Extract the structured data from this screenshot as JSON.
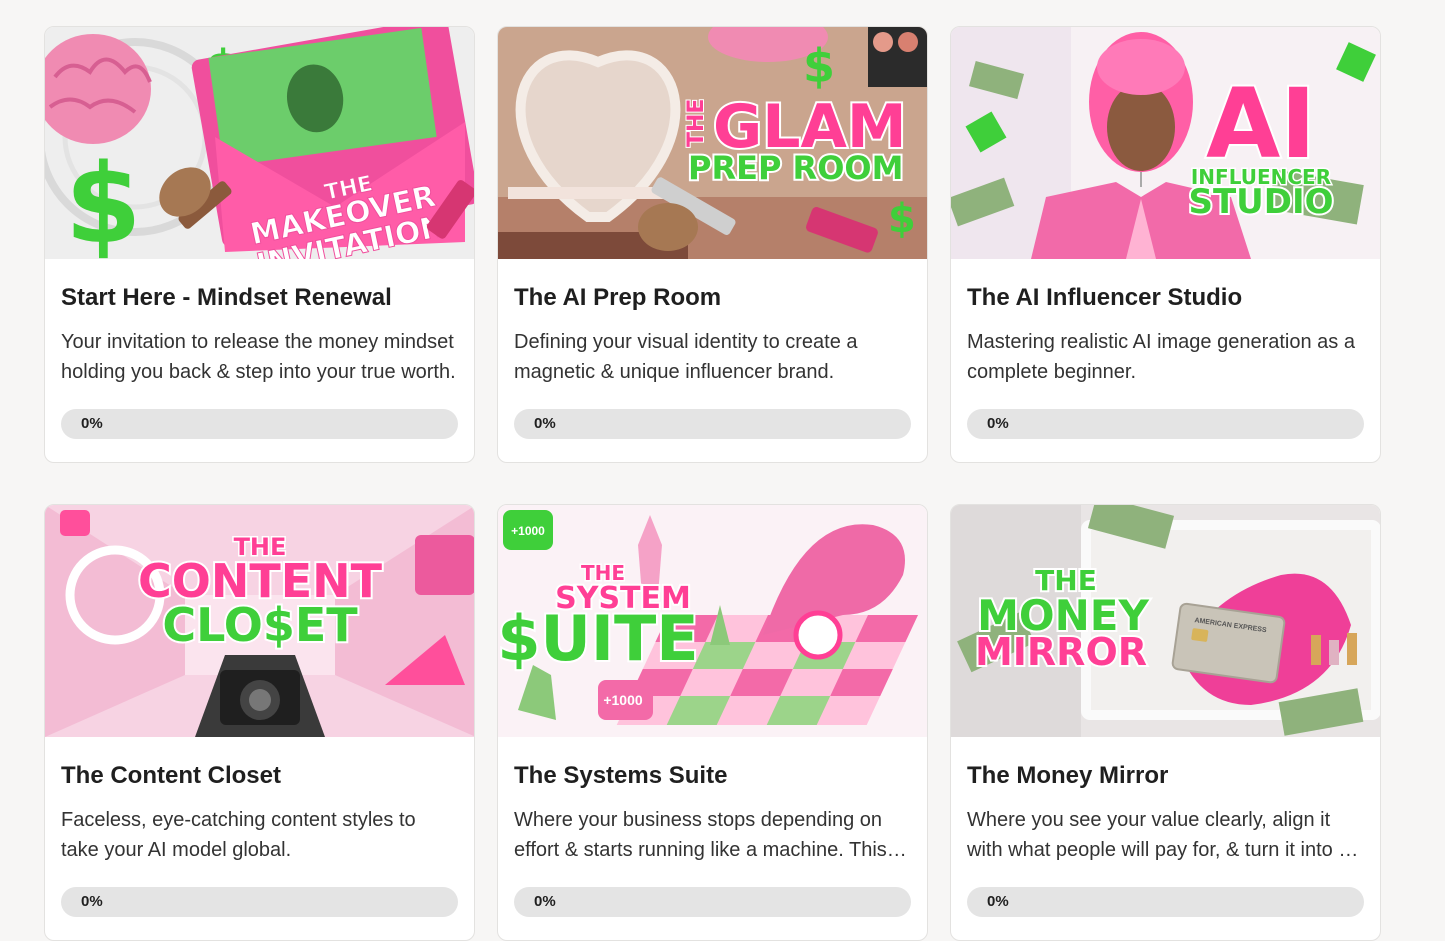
{
  "courses": [
    {
      "title": "Start Here - Mindset Renewal",
      "description": "Your invitation to release the money mindset holding you back & step into your true worth.",
      "progress_percent": 0,
      "progress_label": "0%",
      "thumbnail": {
        "line1": "THE",
        "line2": "MAKEOVER",
        "line3": "INVITATION",
        "icon": "money-envelope-icon"
      }
    },
    {
      "title": "The AI Prep Room",
      "description": "Defining your visual identity to create a magnetic & unique influencer brand.",
      "progress_percent": 0,
      "progress_label": "0%",
      "thumbnail": {
        "line1": "THE",
        "line2": "GLAM",
        "line3": "PREP ROOM",
        "icon": "heart-mirror-icon"
      }
    },
    {
      "title": "The AI Influencer Studio",
      "description": "Mastering realistic AI image generation as a complete beginner.",
      "progress_percent": 0,
      "progress_label": "0%",
      "thumbnail": {
        "line1": "AI",
        "line2": "INFLUENCER",
        "line3": "STUDIO",
        "icon": "balloon-face-icon"
      }
    },
    {
      "title": "The Content Closet",
      "description": "Faceless, eye-catching content styles to take your AI model global.",
      "progress_percent": 0,
      "progress_label": "0%",
      "thumbnail": {
        "line1": "THE",
        "line2": "CONTENT",
        "line3": "CLO$ET",
        "icon": "camera-icon"
      }
    },
    {
      "title": "The Systems Suite",
      "description": "Where your business stops depending on effort & starts running like a machine. This is where you build automated systems.",
      "progress_percent": 0,
      "progress_label": "0%",
      "thumbnail": {
        "line1": "THE",
        "line2": "SYSTEM",
        "line3": "$UITE",
        "badge": "+1000",
        "icon": "chess-board-icon"
      }
    },
    {
      "title": "The Money Mirror",
      "description": "Where you see your value clearly, align it with what people will pay for, & turn it into an offer that sells.",
      "progress_percent": 0,
      "progress_label": "0%",
      "thumbnail": {
        "line1": "THE",
        "line2": "MONEY",
        "line3": "MIRROR",
        "card_text": "AMERICAN EXPRESS",
        "icon": "card-hand-icon"
      }
    }
  ],
  "colors": {
    "pink": "#e8418f",
    "green": "#3fcf3a",
    "progress_track": "#e4e4e4"
  }
}
